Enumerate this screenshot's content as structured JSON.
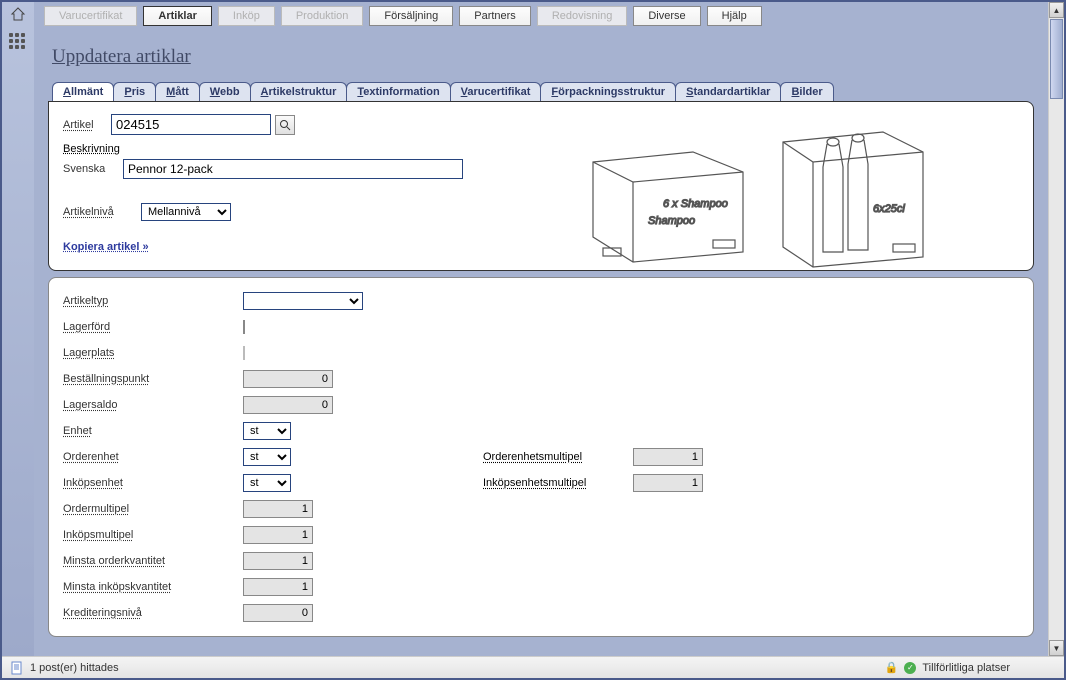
{
  "topnav": [
    {
      "label": "Varucertifikat",
      "state": "disabled"
    },
    {
      "label": "Artiklar",
      "state": "active"
    },
    {
      "label": "Inköp",
      "state": "disabled"
    },
    {
      "label": "Produktion",
      "state": "disabled"
    },
    {
      "label": "Försäljning",
      "state": ""
    },
    {
      "label": "Partners",
      "state": ""
    },
    {
      "label": "Redovisning",
      "state": "disabled"
    },
    {
      "label": "Diverse",
      "state": ""
    },
    {
      "label": "Hjälp",
      "state": ""
    }
  ],
  "page_title": "Uppdatera artiklar",
  "subtabs": [
    "Allmänt",
    "Pris",
    "Mått",
    "Webb",
    "Artikelstruktur",
    "Textinformation",
    "Varucertifikat",
    "Förpackningsstruktur",
    "Standardartiklar",
    "Bilder"
  ],
  "subtab_active": 0,
  "form": {
    "artikel_label": "Artikel",
    "artikel_value": "024515",
    "beskrivning_label": "Beskrivning",
    "svenska_label": "Svenska",
    "svenska_value": "Pennor 12-pack",
    "artikelniva_label": "Artikelnivå",
    "artikelniva_value": "Mellannivå",
    "kopiera_link": "Kopiera artikel »"
  },
  "grid": {
    "artikeltyp": {
      "label": "Artikeltyp",
      "value": ""
    },
    "lagerford": {
      "label": "Lagerförd",
      "checked": false
    },
    "lagerplats": {
      "label": "Lagerplats",
      "value": ""
    },
    "bestallningspunkt": {
      "label": "Beställningspunkt",
      "value": "0"
    },
    "lagersaldo": {
      "label": "Lagersaldo",
      "value": "0"
    },
    "enhet": {
      "label": "Enhet",
      "value": "st"
    },
    "orderenhet": {
      "label": "Orderenhet",
      "value": "st"
    },
    "orderenhetsmultipel": {
      "label": "Orderenhetsmultipel",
      "value": "1"
    },
    "inkopsenhet": {
      "label": "Inköpsenhet",
      "value": "st"
    },
    "inkopsenhetsmultipel": {
      "label": "Inköpsenhetsmultipel",
      "value": "1"
    },
    "ordermultipel": {
      "label": "Ordermultipel",
      "value": "1"
    },
    "inkopsmultipel": {
      "label": "Inköpsmultipel",
      "value": "1"
    },
    "minsta_orderkvantitet": {
      "label": "Minsta orderkvantitet",
      "value": "1"
    },
    "minsta_inkopskvantitet": {
      "label": "Minsta inköpskvantitet",
      "value": "1"
    },
    "krediteringsniva": {
      "label": "Krediteringsnivå",
      "value": "0"
    }
  },
  "status": {
    "posts": "1 post(er) hittades",
    "trusted": "Tillförlitliga platser"
  },
  "illustration": {
    "box_text": "6 x Shampoo",
    "carrier_text": "6x25cl"
  }
}
